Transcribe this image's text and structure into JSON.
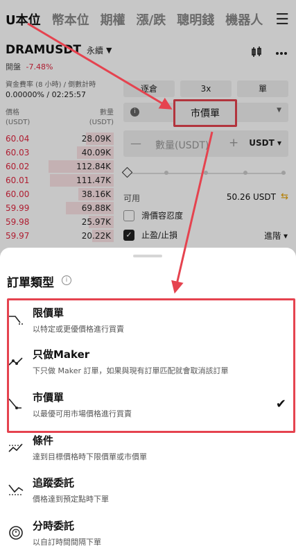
{
  "tabs": [
    {
      "label": "U本位"
    },
    {
      "label": "幣本位"
    },
    {
      "label": "期權"
    },
    {
      "label": "漲/跌"
    },
    {
      "label": "聰明錢"
    },
    {
      "label": "機器人"
    }
  ],
  "menu_icon": "hamburger-icon",
  "pair": {
    "symbol": "DRAMUSDT",
    "contract": "永續",
    "status": "開盤",
    "change": "-7.48%"
  },
  "header_icons": [
    "chart-icon",
    "more-icon"
  ],
  "funding": {
    "label": "資金費率 (8 小時) / 倒數計時",
    "value": "0.00000% / 02:25:57"
  },
  "orderbook": {
    "price_header": "價格",
    "price_unit": "(USDT)",
    "qty_header": "數量",
    "qty_unit": "(USDT)",
    "rows": [
      {
        "price": "60.04",
        "qty": "28.09K",
        "depth": 0.42
      },
      {
        "price": "60.03",
        "qty": "40.09K",
        "depth": 0.55
      },
      {
        "price": "60.02",
        "qty": "112.84K",
        "depth": 0.98
      },
      {
        "price": "60.01",
        "qty": "111.47K",
        "depth": 0.96
      },
      {
        "price": "60.00",
        "qty": "38.16K",
        "depth": 0.53
      },
      {
        "price": "59.99",
        "qty": "69.88K",
        "depth": 0.72
      },
      {
        "price": "59.98",
        "qty": "25.97K",
        "depth": 0.38
      },
      {
        "price": "59.97",
        "qty": "20.22K",
        "depth": 0.32
      }
    ]
  },
  "order_form": {
    "margin_mode": "逐倉",
    "leverage": "3x",
    "position_mode": "單",
    "order_type": "市價單",
    "qty_placeholder": "數量(USDT)",
    "qty_unit": "USDT",
    "available_label": "可用",
    "available_value": "50.26 USDT",
    "slippage_label": "滑價容忍度",
    "tpsl_label": "止盈/止損",
    "advanced_label": "進階"
  },
  "sheet": {
    "title": "訂單類型",
    "options": [
      {
        "name": "限價單",
        "desc": "以特定或更優價格進行買賣",
        "icon": "limit-order-icon",
        "selected": false
      },
      {
        "name": "只做Maker",
        "desc": "下只做 Maker 訂單，如果與現有訂單匹配就會取消該訂單",
        "icon": "maker-only-icon",
        "selected": false
      },
      {
        "name": "市價單",
        "desc": "以最優可用市場價格進行買賣",
        "icon": "market-order-icon",
        "selected": true
      },
      {
        "name": "條件",
        "desc": "達到目標價格時下限價單或市價單",
        "icon": "conditional-order-icon",
        "selected": false
      },
      {
        "name": "追蹤委託",
        "desc": "價格達到預定點時下單",
        "icon": "trailing-order-icon",
        "selected": false
      },
      {
        "name": "分時委託",
        "desc": "以自訂時間間隔下單",
        "icon": "twap-order-icon",
        "selected": false
      }
    ]
  },
  "colors": {
    "accent_red": "#e5434f",
    "sell_red": "#e0263f",
    "depth_bg": "#fbe3e6",
    "highlight": "#e7a100"
  }
}
